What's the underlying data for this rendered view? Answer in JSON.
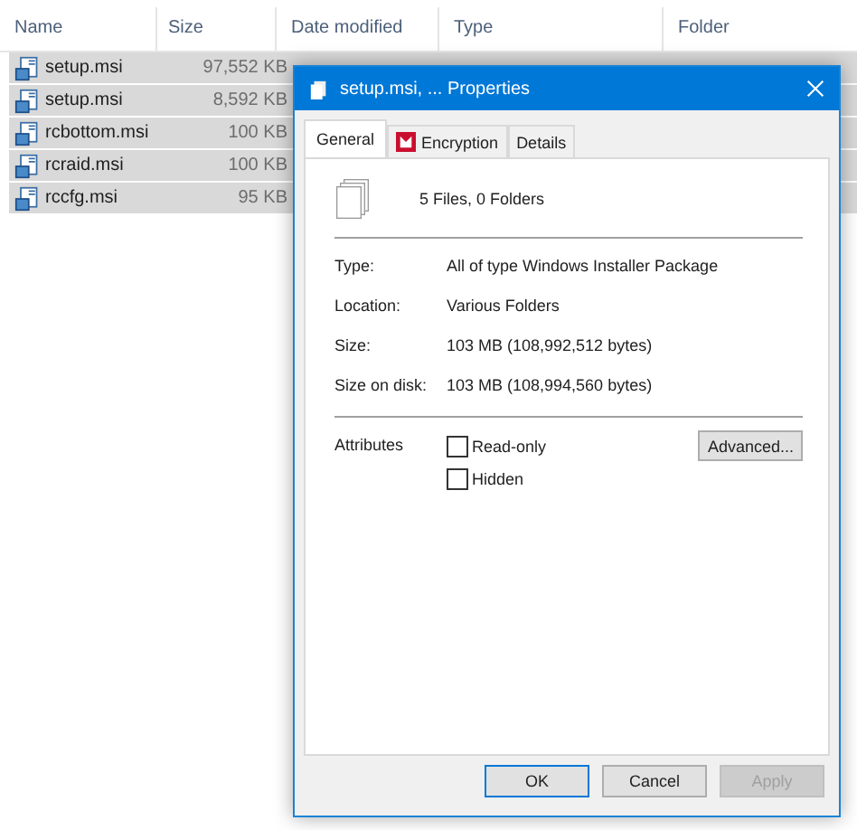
{
  "explorer": {
    "columns": [
      "Name",
      "Size",
      "Date modified",
      "Type",
      "Folder"
    ],
    "rows": [
      {
        "name": "setup.msi",
        "size": "97,552 KB",
        "selected": true
      },
      {
        "name": "setup.msi",
        "size": "8,592 KB",
        "selected": true
      },
      {
        "name": "rcbottom.msi",
        "size": "100 KB",
        "selected": true
      },
      {
        "name": "rcraid.msi",
        "size": "100 KB",
        "selected": true
      },
      {
        "name": "rccfg.msi",
        "size": "95 KB",
        "selected": true
      }
    ]
  },
  "dialog": {
    "title": "setup.msi, ... Properties",
    "tabs": [
      {
        "label": "General",
        "selected": true,
        "kind": "plain"
      },
      {
        "label": "Encryption",
        "selected": false,
        "kind": "shield"
      },
      {
        "label": "Details",
        "selected": false,
        "kind": "plain"
      }
    ],
    "summary": "5 Files, 0 Folders",
    "properties": [
      {
        "label": "Type:",
        "value": "All of type Windows Installer Package"
      },
      {
        "label": "Location:",
        "value": "Various Folders"
      },
      {
        "label": "Size:",
        "value": "103 MB (108,992,512 bytes)"
      },
      {
        "label": "Size on disk:",
        "value": "103 MB (108,994,560 bytes)"
      }
    ],
    "attributes_label": "Attributes",
    "attributes": [
      {
        "label": "Read-only",
        "checked": false
      },
      {
        "label": "Hidden",
        "checked": false
      }
    ],
    "advanced_button": "Advanced...",
    "buttons": [
      {
        "label": "OK",
        "disabled": false,
        "default": true
      },
      {
        "label": "Cancel",
        "disabled": false,
        "default": false
      },
      {
        "label": "Apply",
        "disabled": true,
        "default": false
      }
    ]
  }
}
